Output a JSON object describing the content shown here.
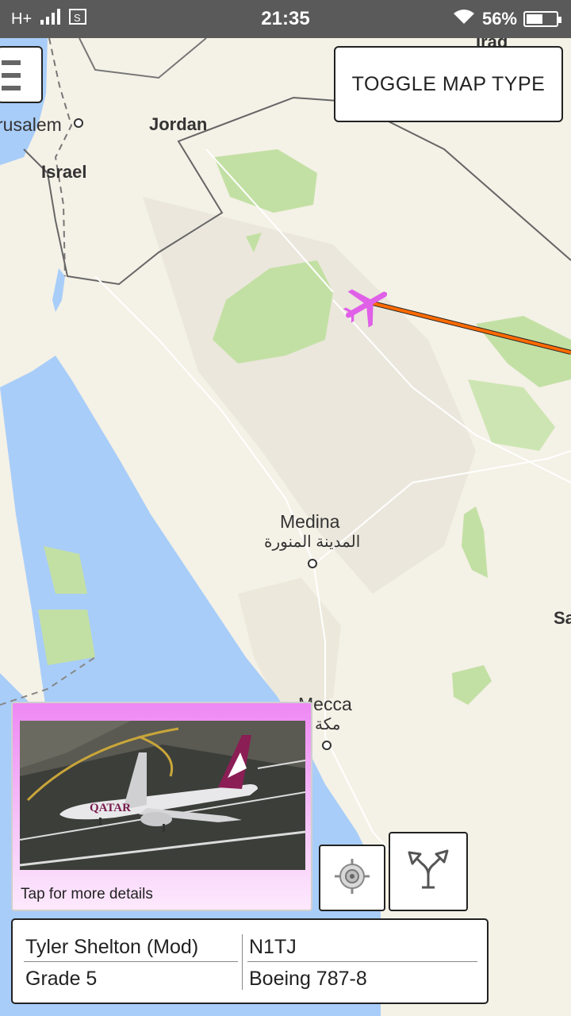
{
  "status_bar": {
    "network": "H+",
    "signal_icon": "signal-bars-icon",
    "screenshot_icon": "screenshot-icon",
    "time": "21:35",
    "wifi_icon": "wifi-icon",
    "battery_percent": "56%",
    "battery_level": 0.56
  },
  "map": {
    "labels": {
      "jerusalem": "rusalem",
      "jordan": "Jordan",
      "israel": "Israel",
      "iraq": "Iraq",
      "medina": "Medina",
      "medina_ar": "المدينة المنورة",
      "mecca": "Mecca",
      "mecca_ar": "مكة",
      "saudi": "Sa"
    },
    "colors": {
      "land": "#f4f1e6",
      "water": "#a8cdf9",
      "park": "#c3e0a4",
      "route": "#ff6a00",
      "aircraft": "#e060e8"
    }
  },
  "controls": {
    "menu_icon": "hamburger-menu-icon",
    "toggle_map_type": "TOGGLE MAP TYPE",
    "locate_icon": "gps-target-icon",
    "route_icon": "route-split-icon"
  },
  "flight_card": {
    "caption": "Tap for more details",
    "photo_text": "QATAR"
  },
  "info": {
    "pilot": "Tyler Shelton (Mod)",
    "callsign": "N1TJ",
    "grade": "Grade 5",
    "aircraft": "Boeing 787-8"
  }
}
